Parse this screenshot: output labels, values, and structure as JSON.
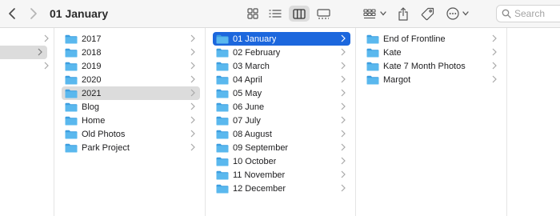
{
  "window": {
    "title": "01 January"
  },
  "toolbar": {
    "icons": [
      "back-chevron-icon",
      "forward-chevron-icon",
      "icon-view-icon",
      "list-view-icon",
      "column-view-icon",
      "gallery-view-icon",
      "group-icon",
      "share-icon",
      "tag-icon",
      "more-actions-icon"
    ],
    "active_view": "column",
    "search_placeholder": "Search"
  },
  "columns": {
    "col0": {
      "rows": 3,
      "selected_index": 1
    },
    "col1": {
      "items": [
        "2017",
        "2018",
        "2019",
        "2020",
        "2021",
        "Blog",
        "Home",
        "Old Photos",
        "Park Project"
      ],
      "selected": "2021"
    },
    "col2": {
      "items": [
        "01 January",
        "02 February",
        "03 March",
        "04 April",
        "05 May",
        "06 June",
        "07 July",
        "08 August",
        "09 September",
        "10 October",
        "11 November",
        "12 December"
      ],
      "selected": "01 January"
    },
    "col3": {
      "items": [
        "End of Frontline",
        "Kate",
        "Kate 7 Month Photos",
        "Margot"
      ]
    }
  },
  "colors": {
    "selection_blue": "#1c67dd",
    "selection_gray": "#dcdcdc",
    "folder_blue": "#5ab8ee"
  }
}
